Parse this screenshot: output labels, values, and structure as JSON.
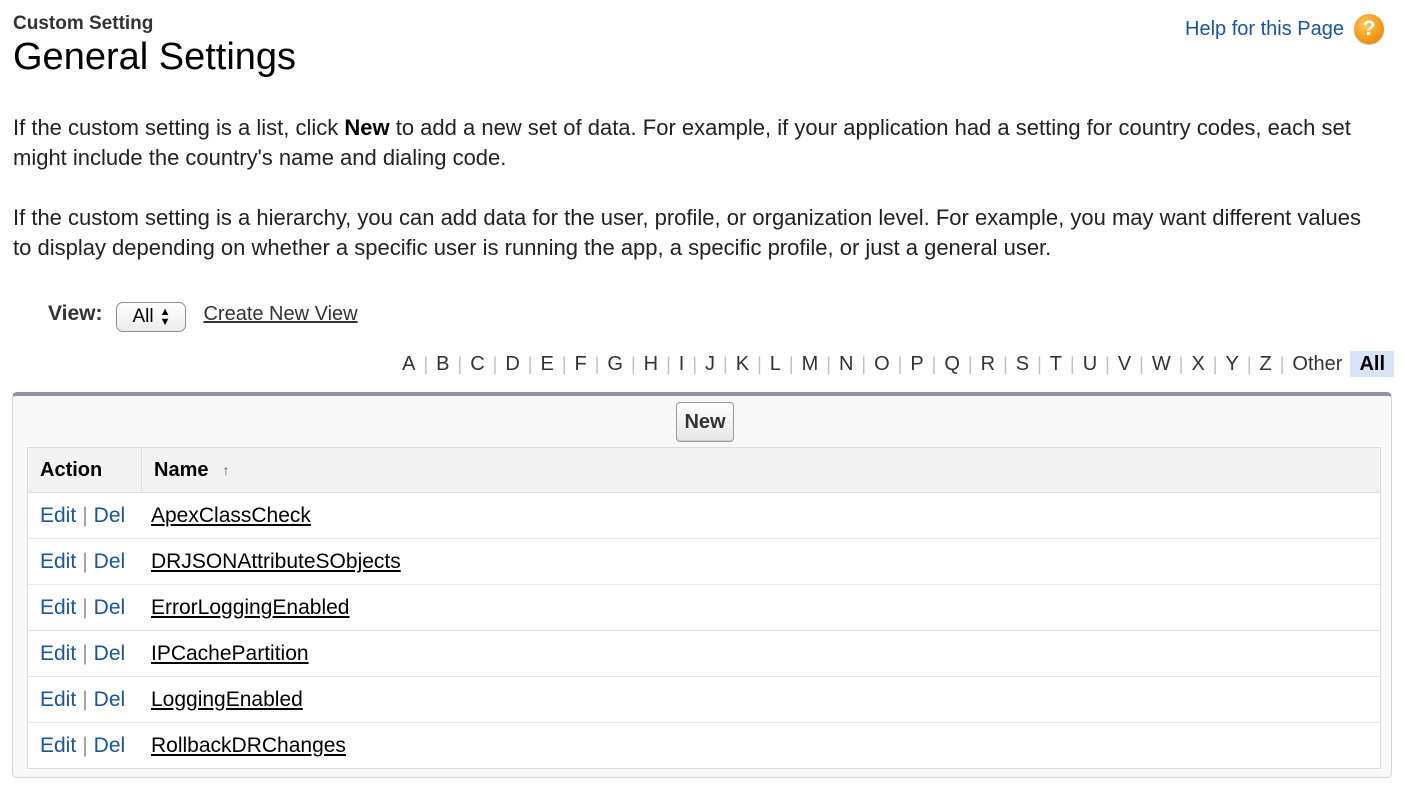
{
  "header": {
    "eyebrow": "Custom Setting",
    "title": "General Settings",
    "help_link": "Help for this Page",
    "help_icon_glyph": "?"
  },
  "intro": {
    "p1_pre": "If the custom setting is a list, click ",
    "p1_bold": "New",
    "p1_post": " to add a new set of data. For example, if your application had a setting for country codes, each set might include the country's name and dialing code.",
    "p2": "If the custom setting is a hierarchy, you can add data for the user, profile, or organization level. For example, you may want different values to display depending on whether a specific user is running the app, a specific profile, or just a general user."
  },
  "view": {
    "label": "View:",
    "selected": "All",
    "create_link": "Create New View"
  },
  "alphabet": {
    "letters": [
      "A",
      "B",
      "C",
      "D",
      "E",
      "F",
      "G",
      "H",
      "I",
      "J",
      "K",
      "L",
      "M",
      "N",
      "O",
      "P",
      "Q",
      "R",
      "S",
      "T",
      "U",
      "V",
      "W",
      "X",
      "Y",
      "Z",
      "Other",
      "All"
    ],
    "active": "All"
  },
  "toolbar": {
    "new_label": "New"
  },
  "table": {
    "columns": {
      "action": "Action",
      "name": "Name"
    },
    "sort_icon": "↑",
    "edit_label": "Edit",
    "del_label": "Del",
    "separator": "|",
    "rows": [
      "ApexClassCheck",
      "DRJSONAttributeSObjects",
      "ErrorLoggingEnabled",
      "IPCachePartition",
      "LoggingEnabled",
      "RollbackDRChanges"
    ]
  },
  "colors": {
    "link_blue": "#1a55a3",
    "panel_top_border": "#8b94a3",
    "active_letter_bg": "#d8e5f6",
    "help_icon_orange": "#f29b1b"
  }
}
